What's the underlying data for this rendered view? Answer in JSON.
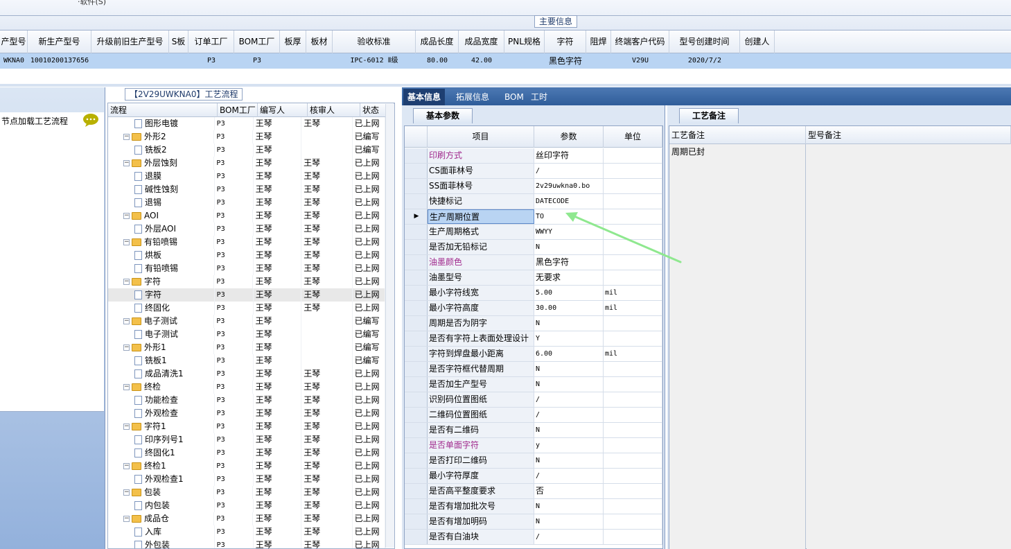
{
  "top": {
    "fragment": "·软件(S)",
    "main_info_label": "主要信息"
  },
  "header": {
    "columns": [
      {
        "label": "产型号",
        "w": 40
      },
      {
        "label": "新生产型号",
        "w": 92
      },
      {
        "label": "升级前旧生产型号",
        "w": 112
      },
      {
        "label": "S板",
        "w": 28
      },
      {
        "label": "订单工厂",
        "w": 66
      },
      {
        "label": "BOM工厂",
        "w": 66
      },
      {
        "label": "板厚",
        "w": 38
      },
      {
        "label": "板材",
        "w": 38
      },
      {
        "label": "验收标准",
        "w": 120
      },
      {
        "label": "成品长度",
        "w": 62
      },
      {
        "label": "成品宽度",
        "w": 66
      },
      {
        "label": "PNL规格",
        "w": 58
      },
      {
        "label": "字符",
        "w": 60
      },
      {
        "label": "阻焊",
        "w": 36
      },
      {
        "label": "终端客户代码",
        "w": 84
      },
      {
        "label": "型号创建时间",
        "w": 102
      },
      {
        "label": "创建人",
        "w": 50
      }
    ],
    "row": [
      "WKNA0",
      "10010200137656",
      "",
      "",
      "P3",
      "P3",
      "",
      "",
      "IPC-6012 Ⅱ级",
      "80.00",
      "42.00",
      "",
      "黑色字符",
      "",
      "V29U",
      "2020/7/2",
      ""
    ]
  },
  "left_panel": {
    "node_load_text": "节点加载工艺流程"
  },
  "flow": {
    "title": "【2V29UWKNA0】工艺流程",
    "columns": [
      "流程",
      "BOM工厂",
      "编写人",
      "核审人",
      "状态"
    ],
    "rows": [
      {
        "name": "图形电镀",
        "level": 2,
        "bom": "P3",
        "writer": "王琴",
        "reviewer": "王琴",
        "status": "已上网"
      },
      {
        "name": "外形2",
        "level": 1,
        "bom": "P3",
        "writer": "王琴",
        "reviewer": "",
        "status": "已编写"
      },
      {
        "name": "铣板2",
        "level": 2,
        "bom": "P3",
        "writer": "王琴",
        "reviewer": "",
        "status": "已编写"
      },
      {
        "name": "外层蚀刻",
        "level": 1,
        "bom": "P3",
        "writer": "王琴",
        "reviewer": "王琴",
        "status": "已上网"
      },
      {
        "name": "退膜",
        "level": 2,
        "bom": "P3",
        "writer": "王琴",
        "reviewer": "王琴",
        "status": "已上网"
      },
      {
        "name": "碱性蚀刻",
        "level": 2,
        "bom": "P3",
        "writer": "王琴",
        "reviewer": "王琴",
        "status": "已上网"
      },
      {
        "name": "退锡",
        "level": 2,
        "bom": "P3",
        "writer": "王琴",
        "reviewer": "王琴",
        "status": "已上网"
      },
      {
        "name": "AOI",
        "level": 1,
        "bom": "P3",
        "writer": "王琴",
        "reviewer": "王琴",
        "status": "已上网"
      },
      {
        "name": "外层AOI",
        "level": 2,
        "bom": "P3",
        "writer": "王琴",
        "reviewer": "王琴",
        "status": "已上网"
      },
      {
        "name": "有铅喷锡",
        "level": 1,
        "bom": "P3",
        "writer": "王琴",
        "reviewer": "王琴",
        "status": "已上网"
      },
      {
        "name": "烘板",
        "level": 2,
        "bom": "P3",
        "writer": "王琴",
        "reviewer": "王琴",
        "status": "已上网"
      },
      {
        "name": "有铅喷锡",
        "level": 2,
        "bom": "P3",
        "writer": "王琴",
        "reviewer": "王琴",
        "status": "已上网"
      },
      {
        "name": "字符",
        "level": 1,
        "bom": "P3",
        "writer": "王琴",
        "reviewer": "王琴",
        "status": "已上网"
      },
      {
        "name": "字符",
        "level": 2,
        "bom": "P3",
        "writer": "王琴",
        "reviewer": "王琴",
        "status": "已上网",
        "selected": true
      },
      {
        "name": "终固化",
        "level": 2,
        "bom": "P3",
        "writer": "王琴",
        "reviewer": "王琴",
        "status": "已上网"
      },
      {
        "name": "电子测试",
        "level": 1,
        "bom": "P3",
        "writer": "王琴",
        "reviewer": "",
        "status": "已编写"
      },
      {
        "name": "电子测试",
        "level": 2,
        "bom": "P3",
        "writer": "王琴",
        "reviewer": "",
        "status": "已编写"
      },
      {
        "name": "外形1",
        "level": 1,
        "bom": "P3",
        "writer": "王琴",
        "reviewer": "",
        "status": "已编写"
      },
      {
        "name": "铣板1",
        "level": 2,
        "bom": "P3",
        "writer": "王琴",
        "reviewer": "",
        "status": "已编写"
      },
      {
        "name": "成品清洗1",
        "level": 2,
        "bom": "P3",
        "writer": "王琴",
        "reviewer": "王琴",
        "status": "已上网"
      },
      {
        "name": "终检",
        "level": 1,
        "bom": "P3",
        "writer": "王琴",
        "reviewer": "王琴",
        "status": "已上网"
      },
      {
        "name": "功能检查",
        "level": 2,
        "bom": "P3",
        "writer": "王琴",
        "reviewer": "王琴",
        "status": "已上网"
      },
      {
        "name": "外观检查",
        "level": 2,
        "bom": "P3",
        "writer": "王琴",
        "reviewer": "王琴",
        "status": "已上网"
      },
      {
        "name": "字符1",
        "level": 1,
        "bom": "P3",
        "writer": "王琴",
        "reviewer": "王琴",
        "status": "已上网"
      },
      {
        "name": "印序列号1",
        "level": 2,
        "bom": "P3",
        "writer": "王琴",
        "reviewer": "王琴",
        "status": "已上网"
      },
      {
        "name": "终固化1",
        "level": 2,
        "bom": "P3",
        "writer": "王琴",
        "reviewer": "王琴",
        "status": "已上网"
      },
      {
        "name": "终检1",
        "level": 1,
        "bom": "P3",
        "writer": "王琴",
        "reviewer": "王琴",
        "status": "已上网"
      },
      {
        "name": "外观检查1",
        "level": 2,
        "bom": "P3",
        "writer": "王琴",
        "reviewer": "王琴",
        "status": "已上网"
      },
      {
        "name": "包装",
        "level": 1,
        "bom": "P3",
        "writer": "王琴",
        "reviewer": "王琴",
        "status": "已上网"
      },
      {
        "name": "内包装",
        "level": 2,
        "bom": "P3",
        "writer": "王琴",
        "reviewer": "王琴",
        "status": "已上网"
      },
      {
        "name": "成品仓",
        "level": 1,
        "bom": "P3",
        "writer": "王琴",
        "reviewer": "王琴",
        "status": "已上网"
      },
      {
        "name": "入库",
        "level": 2,
        "bom": "P3",
        "writer": "王琴",
        "reviewer": "王琴",
        "status": "已上网"
      },
      {
        "name": "外包装",
        "level": 2,
        "bom": "P3",
        "writer": "王琴",
        "reviewer": "王琴",
        "status": "已上网"
      }
    ]
  },
  "right_tabs": [
    "基本信息",
    "拓展信息",
    "BOM",
    "工时"
  ],
  "basic": {
    "tab": "基本参数",
    "columns": [
      "项目",
      "参数",
      "单位"
    ],
    "rows": [
      {
        "item": "印刷方式",
        "value": "丝印字符",
        "unit": "",
        "purple": true
      },
      {
        "item": "CS面菲林号",
        "value": "/",
        "unit": ""
      },
      {
        "item": "SS面菲林号",
        "value": "2v29uwkna0.bo",
        "unit": ""
      },
      {
        "item": "快捷标记",
        "value": "DATECODE",
        "unit": ""
      },
      {
        "item": "生产周期位置",
        "value": "TO",
        "unit": "",
        "selected": true
      },
      {
        "item": "生产周期格式",
        "value": "WWYY",
        "unit": ""
      },
      {
        "item": "是否加无铅标记",
        "value": "N",
        "unit": ""
      },
      {
        "item": "油墨颜色",
        "value": "黑色字符",
        "unit": "",
        "purple": true
      },
      {
        "item": "油墨型号",
        "value": "无要求",
        "unit": ""
      },
      {
        "item": "最小字符线宽",
        "value": "5.00",
        "unit": "mil"
      },
      {
        "item": "最小字符高度",
        "value": "30.00",
        "unit": "mil"
      },
      {
        "item": "周期是否为阴字",
        "value": "N",
        "unit": ""
      },
      {
        "item": "是否有字符上表面处理设计",
        "value": "Y",
        "unit": ""
      },
      {
        "item": "字符到焊盘最小距离",
        "value": "6.00",
        "unit": "mil"
      },
      {
        "item": "是否字符框代替周期",
        "value": "N",
        "unit": ""
      },
      {
        "item": "是否加生产型号",
        "value": "N",
        "unit": ""
      },
      {
        "item": "识别码位置图纸",
        "value": "/",
        "unit": ""
      },
      {
        "item": "二维码位置图纸",
        "value": "/",
        "unit": ""
      },
      {
        "item": "是否有二维码",
        "value": "N",
        "unit": ""
      },
      {
        "item": "是否单面字符",
        "value": "y",
        "unit": "",
        "purple": true
      },
      {
        "item": "是否打印二维码",
        "value": "N",
        "unit": ""
      },
      {
        "item": "最小字符厚度",
        "value": "/",
        "unit": ""
      },
      {
        "item": "是否高平整度要求",
        "value": "否",
        "unit": ""
      },
      {
        "item": "是否有增加批次号",
        "value": "N",
        "unit": ""
      },
      {
        "item": "是否有增加明码",
        "value": "N",
        "unit": ""
      },
      {
        "item": "是否有白油块",
        "value": "/",
        "unit": ""
      }
    ]
  },
  "notes": {
    "tab": "工艺备注",
    "columns": [
      "工艺备注",
      "型号备注"
    ],
    "craft_note": "周期已封"
  },
  "colors": {
    "accent": "#2f5d9a",
    "selection": "#b9d4f3",
    "purple_label": "#a0288c",
    "arrow": "#8fe88f"
  }
}
